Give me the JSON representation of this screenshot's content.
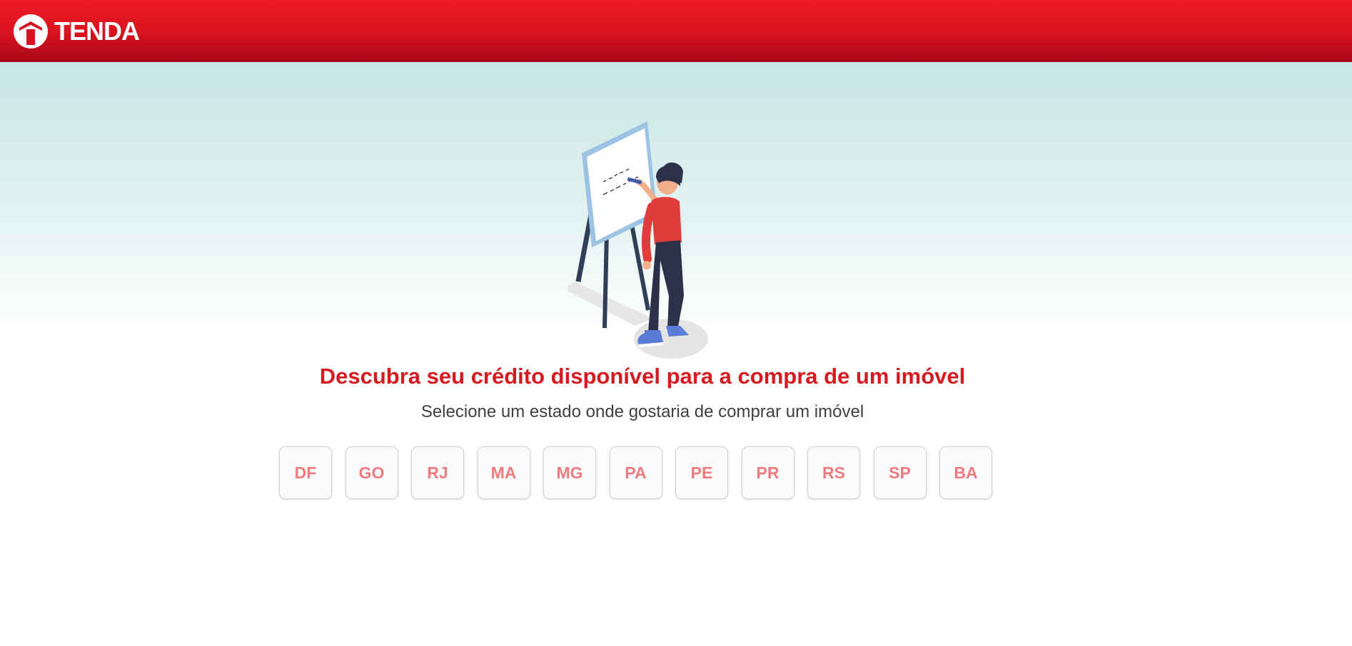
{
  "header": {
    "logo_text": "TENDA",
    "background_color": "#d8121f"
  },
  "main": {
    "title": "Descubra seu crédito disponível para a compra de um imóvel",
    "subtitle": "Selecione um estado onde gostaria de comprar um imóvel",
    "title_color": "#d71920",
    "states": [
      "DF",
      "GO",
      "RJ",
      "MA",
      "MG",
      "PA",
      "PE",
      "PR",
      "RS",
      "SP",
      "BA"
    ]
  },
  "icons": {
    "logo": "tenda-house-icon",
    "illustration": "person-at-whiteboard-illustration"
  }
}
